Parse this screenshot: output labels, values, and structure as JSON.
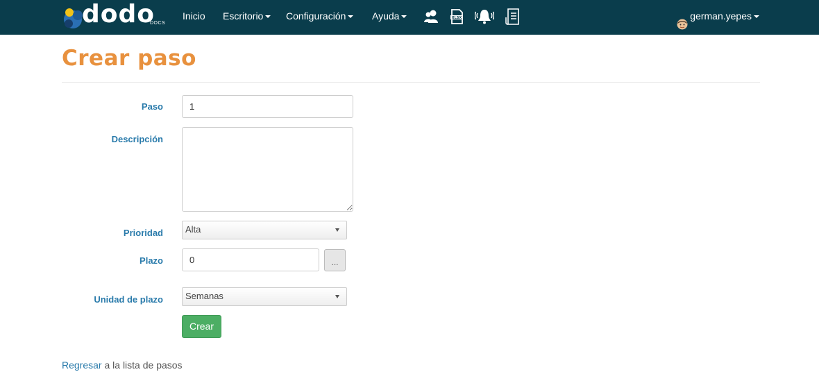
{
  "navbar": {
    "brand_text": "dodo",
    "brand_sub": "DOCS",
    "items": [
      {
        "label": "Inicio"
      },
      {
        "label": "Escritorio"
      },
      {
        "label": "Configuración"
      },
      {
        "label": "Ayuda"
      }
    ],
    "icons": [
      "users-icon",
      "xlsx-file-icon",
      "notification-bell-icon",
      "document-list-icon"
    ],
    "user": "german.yepes"
  },
  "page": {
    "title": "Crear paso"
  },
  "form": {
    "paso": {
      "label": "Paso",
      "value": "1"
    },
    "descripcion": {
      "label": "Descripción",
      "value": ""
    },
    "prioridad": {
      "label": "Prioridad",
      "value": "Alta"
    },
    "plazo": {
      "label": "Plazo",
      "value": "0",
      "button_label": "..."
    },
    "unidad_plazo": {
      "label": "Unidad de plazo",
      "value": "Semanas"
    },
    "submit_label": "Crear"
  },
  "footer": {
    "back_link": "Regresar",
    "back_text": " a la lista de pasos"
  },
  "colors": {
    "navbar_bg": "#0a3d4c",
    "title": "#e8913e",
    "label": "#2a7bab",
    "submit": "#4cae64"
  }
}
